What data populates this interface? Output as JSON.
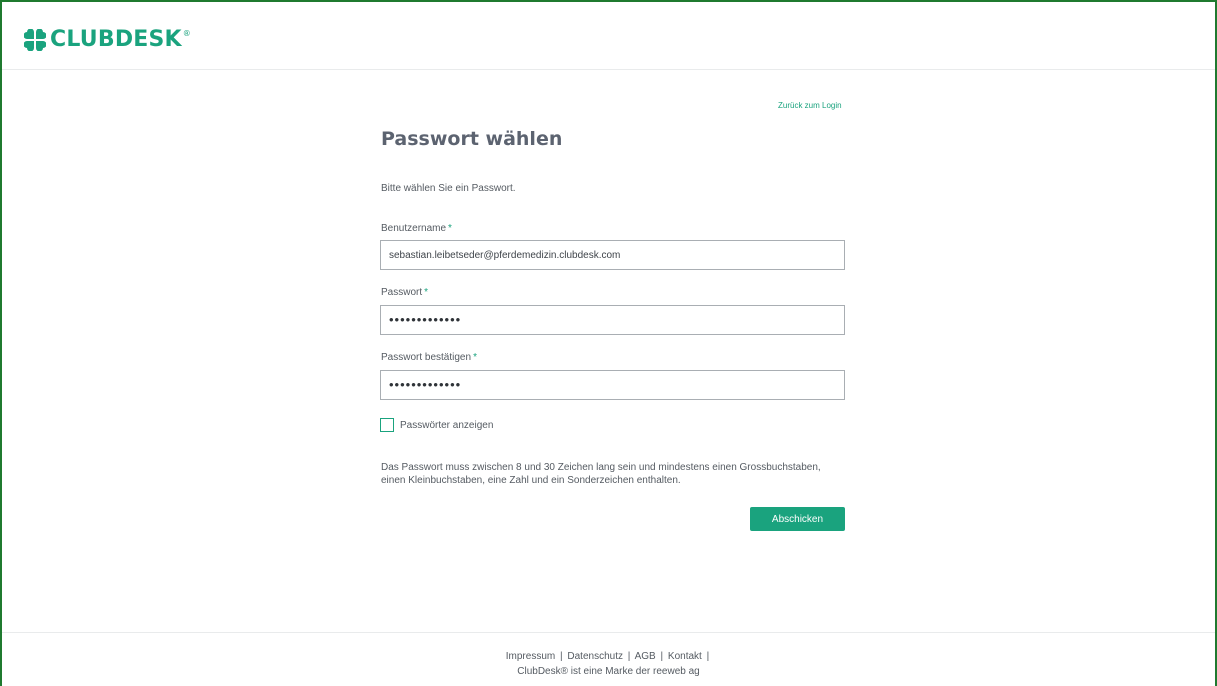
{
  "brand": {
    "name": "CLUBDESK",
    "registered": "®",
    "accent_color": "#1aa37e",
    "logo_icon": "clover-icon"
  },
  "form": {
    "back_link": "Zurück zum Login",
    "title": "Passwort wählen",
    "intro": "Bitte wählen Sie ein Passwort.",
    "username_label": "Benutzername",
    "username_value": "sebastian.leibetseder@pferdemedizin.clubdesk.com",
    "password_label": "Passwort",
    "password_value": "•••••••••••••",
    "confirm_label": "Passwort bestätigen",
    "confirm_value": "•••••••••••••",
    "required_mark": "*",
    "show_passwords_label": "Passwörter anzeigen",
    "show_passwords_checked": false,
    "info_line1": "Das Passwort muss zwischen 8 und 30 Zeichen lang sein und mindestens einen Grossbuchstaben,",
    "info_line2": "einen Kleinbuchstaben, eine Zahl und ein Sonderzeichen enthalten.",
    "submit_label": "Abschicken"
  },
  "footer": {
    "links": [
      "Impressum",
      "Datenschutz",
      "AGB",
      "Kontakt"
    ],
    "separator": "|",
    "note": "ClubDesk® ist eine Marke der reeweb ag"
  }
}
